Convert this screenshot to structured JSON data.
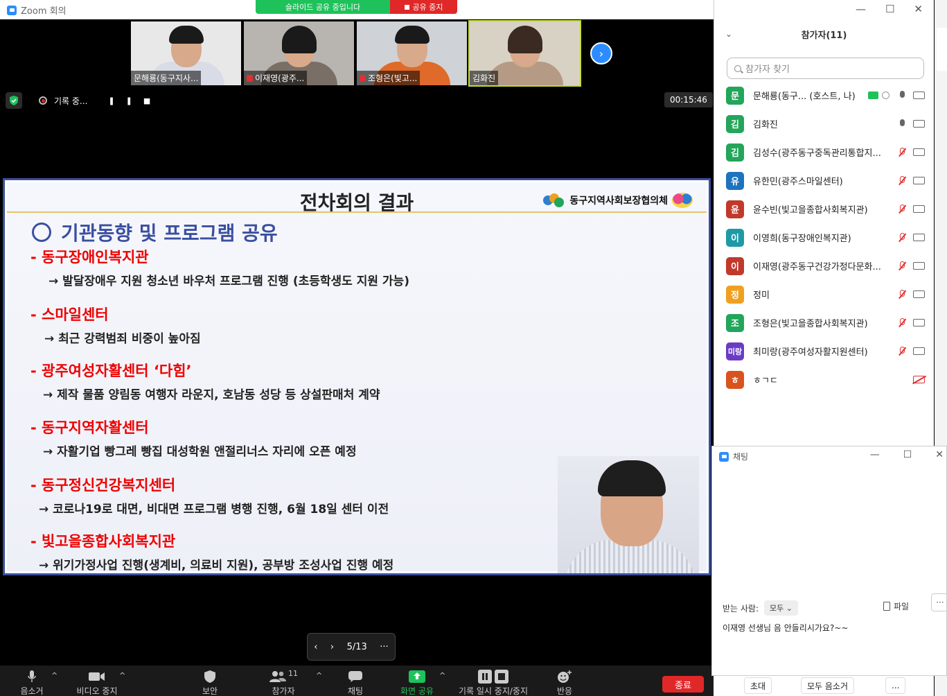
{
  "window": {
    "app_title": "Zoom 회의"
  },
  "share_banner": {
    "status": "슬라이드 공유 중입니다",
    "stop": "공유 중지"
  },
  "thumbnails": [
    {
      "name": "문해룡(동구지사...",
      "muted": false,
      "bg": "#e8e8e8",
      "shirt": "#d9dce6"
    },
    {
      "name": "이재영(광주...",
      "muted": true,
      "bg": "#b8b4b0",
      "shirt": "#7a6f66"
    },
    {
      "name": "조형은(빛고...",
      "muted": true,
      "bg": "#cfd2d6",
      "shirt": "#e06a2a"
    },
    {
      "name": "김화진",
      "muted": false,
      "bg": "#d8d2c4",
      "shirt": "#b59a86"
    }
  ],
  "recording": {
    "label": "기록 중...",
    "pause_icon": "pause-icon",
    "stop_icon": "stop-icon",
    "timer": "00:15:46"
  },
  "slide": {
    "title": "전차회의 결과",
    "logo_text": "동구지역사회보장협의체",
    "heading": "기관동향 및 프로그램 공유",
    "items": [
      {
        "org": "- 동구장애인복지관",
        "desc": "→  발달장애우 지원 청소년 바우처 프로그램 진행 (초등학생도 지원 가능)"
      },
      {
        "org": "- 스마일센터",
        "desc": "→ 최근 강력범죄 비중이 높아짐"
      },
      {
        "org": "- 광주여성자활센터 ‘다힘’",
        "desc": "→ 제작 물품 양림동 여행자 라운지, 호남동 성당 등 상설판매처 계약"
      },
      {
        "org": "- 동구지역자활센터",
        "desc": "→ 자활기업 빵그레 빵집 대성학원 앤절리너스 자리에 오픈 예정"
      },
      {
        "org": "- 동구정신건강복지센터",
        "desc": "→ 코로나19로 대면, 비대면 프로그램 병행 진행, 6월 18일 센터 이전"
      },
      {
        "org": "- 빛고을종합사회복지관",
        "desc": "→ 위기가정사업 진행(생계비, 의료비 지원), 공부방 조성사업 진행 예정"
      }
    ]
  },
  "slide_nav": {
    "page": "5/13"
  },
  "toolbar": {
    "mute": "음소거",
    "video": "비디오 중지",
    "security": "보안",
    "participants": "참가자",
    "participants_count": "11",
    "chat": "채팅",
    "share": "화면 공유",
    "record": "기록 일시 중지/중지",
    "reactions": "반응",
    "end": "종료"
  },
  "participants_panel": {
    "title": "참가자(11)",
    "search_placeholder": "참가자 찾기",
    "list": [
      {
        "initial": "문",
        "color": "#23a55a",
        "name": "문해룡(동구...  (호스트, 나)",
        "mic": "on",
        "cam": "on",
        "host": true
      },
      {
        "initial": "김",
        "color": "#23a55a",
        "name": "김화진",
        "mic": "on",
        "cam": "on"
      },
      {
        "initial": "김",
        "color": "#23a55a",
        "name": "김성수(광주동구중독관리통합지...",
        "mic": "muted",
        "cam": "on"
      },
      {
        "initial": "유",
        "color": "#1e73be",
        "name": "유한민(광주스마일센터)",
        "mic": "muted",
        "cam": "on"
      },
      {
        "initial": "윤",
        "color": "#c0392b",
        "name": "윤수빈(빛고을종합사회복지관)",
        "mic": "muted",
        "cam": "on"
      },
      {
        "initial": "이",
        "color": "#1e9aa6",
        "name": "이영희(동구장애인복지관)",
        "mic": "muted",
        "cam": "on"
      },
      {
        "initial": "이",
        "color": "#c0392b",
        "name": "이재영(광주동구건강가정다문화...",
        "mic": "muted",
        "cam": "on"
      },
      {
        "initial": "정",
        "color": "#f0a020",
        "name": "정미",
        "mic": "muted",
        "cam": "on"
      },
      {
        "initial": "조",
        "color": "#23a55a",
        "name": "조형은(빛고을종합사회복지관)",
        "mic": "muted",
        "cam": "on"
      },
      {
        "initial": "미랑",
        "color": "#6a3cc4",
        "name": "최미랑(광주여성자활지원센터)",
        "mic": "muted",
        "cam": "on"
      },
      {
        "initial": "ㅎ",
        "color": "#d9531e",
        "name": "ㅎㄱㄷ",
        "mic": "none",
        "cam": "off"
      }
    ],
    "invite": "초대",
    "mute_all": "모두 음소거",
    "more": "..."
  },
  "chat": {
    "title": "채팅",
    "to_label": "받는 사람:",
    "to_value": "모두",
    "file": "파일",
    "input_text": "이재영 선생님 음 안들리시가요?~~"
  }
}
